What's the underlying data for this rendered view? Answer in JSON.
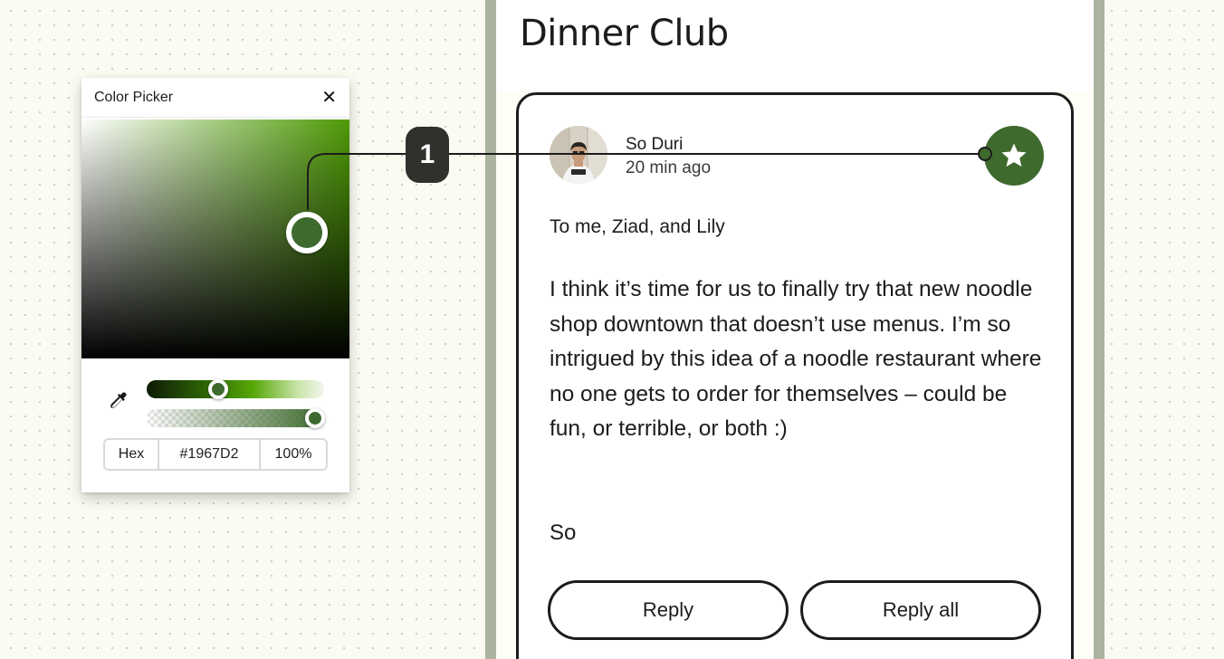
{
  "color_picker": {
    "title": "Color Picker",
    "close_icon": "close-icon",
    "eyedropper_icon": "eyedropper-icon",
    "format_label": "Hex",
    "hex_value": "#1967D2",
    "opacity_value": "100%",
    "hue_level": 0.39,
    "alpha_level": 1.0,
    "selected_swatch_color": "#3f6a2e"
  },
  "callout": {
    "label": "1"
  },
  "email": {
    "subject": "Dinner Club",
    "sender_name": "So Duri",
    "sent_time": "20 min ago",
    "recipients": "To me, Ziad, and Lily",
    "body": "I think it’s time for us to finally try that new noodle shop downtown that doesn’t use menus. I’m so intrigued by this idea of a noodle restaurant where no one gets to order for themselves – could be fun, or terrible, or both :)",
    "signoff": "So",
    "star_icon": "star-icon",
    "reply_label": "Reply",
    "reply_all_label": "Reply all"
  },
  "colors": {
    "accent_green": "#3f6a2e",
    "background": "#fbfbf2",
    "rail": "#aab4a0",
    "callout": "#2f312d"
  }
}
